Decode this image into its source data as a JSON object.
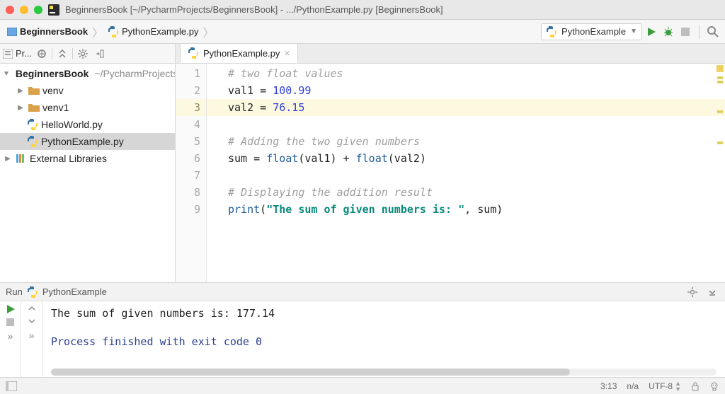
{
  "window": {
    "title": "BeginnersBook [~/PycharmProjects/BeginnersBook] - .../PythonExample.py [BeginnersBook]"
  },
  "breadcrumbs": {
    "project": "BeginnersBook",
    "file": "PythonExample.py"
  },
  "toolbar": {
    "run_config": "PythonExample"
  },
  "project_tool": {
    "title": "Pr...",
    "root_name": "BeginnersBook",
    "root_path": "~/PycharmProjects/BeginnersBook",
    "items": [
      {
        "kind": "folder",
        "label": "venv"
      },
      {
        "kind": "folder",
        "label": "venv1"
      },
      {
        "kind": "pyfile",
        "label": "HelloWorld.py"
      },
      {
        "kind": "pyfile",
        "label": "PythonExample.py",
        "selected": true
      }
    ],
    "external_libs": "External Libraries"
  },
  "editor": {
    "tab": "PythonExample.py",
    "lines": [
      {
        "n": 1,
        "tokens": [
          {
            "t": "# two float values",
            "c": "c-comment"
          }
        ]
      },
      {
        "n": 2,
        "tokens": [
          {
            "t": "val1 = ",
            "c": "c-var"
          },
          {
            "t": "100.99",
            "c": "c-num"
          }
        ]
      },
      {
        "n": 3,
        "hl": true,
        "tokens": [
          {
            "t": "val2 = ",
            "c": "c-var"
          },
          {
            "t": "76.15",
            "c": "c-num"
          }
        ]
      },
      {
        "n": 4,
        "tokens": []
      },
      {
        "n": 5,
        "tokens": [
          {
            "t": "# Adding the two given numbers",
            "c": "c-comment"
          }
        ]
      },
      {
        "n": 6,
        "tokens": [
          {
            "t": "sum = ",
            "c": "c-var"
          },
          {
            "t": "float",
            "c": "c-call"
          },
          {
            "t": "(val1) + ",
            "c": "c-var"
          },
          {
            "t": "float",
            "c": "c-call"
          },
          {
            "t": "(val2)",
            "c": "c-var"
          }
        ]
      },
      {
        "n": 7,
        "tokens": []
      },
      {
        "n": 8,
        "tokens": [
          {
            "t": "# Displaying the addition result",
            "c": "c-comment"
          }
        ]
      },
      {
        "n": 9,
        "tokens": [
          {
            "t": "print",
            "c": "c-call"
          },
          {
            "t": "(",
            "c": "c-var"
          },
          {
            "t": "\"The sum of given numbers is: \"",
            "c": "c-str"
          },
          {
            "t": ", sum)",
            "c": "c-var"
          }
        ]
      }
    ]
  },
  "run_panel": {
    "label": "Run",
    "config": "PythonExample",
    "output_line": "The sum of given numbers is:  177.14",
    "exit_line": "Process finished with exit code 0"
  },
  "status": {
    "caret": "3:13",
    "indent": "n/a",
    "encoding": "UTF-8"
  }
}
